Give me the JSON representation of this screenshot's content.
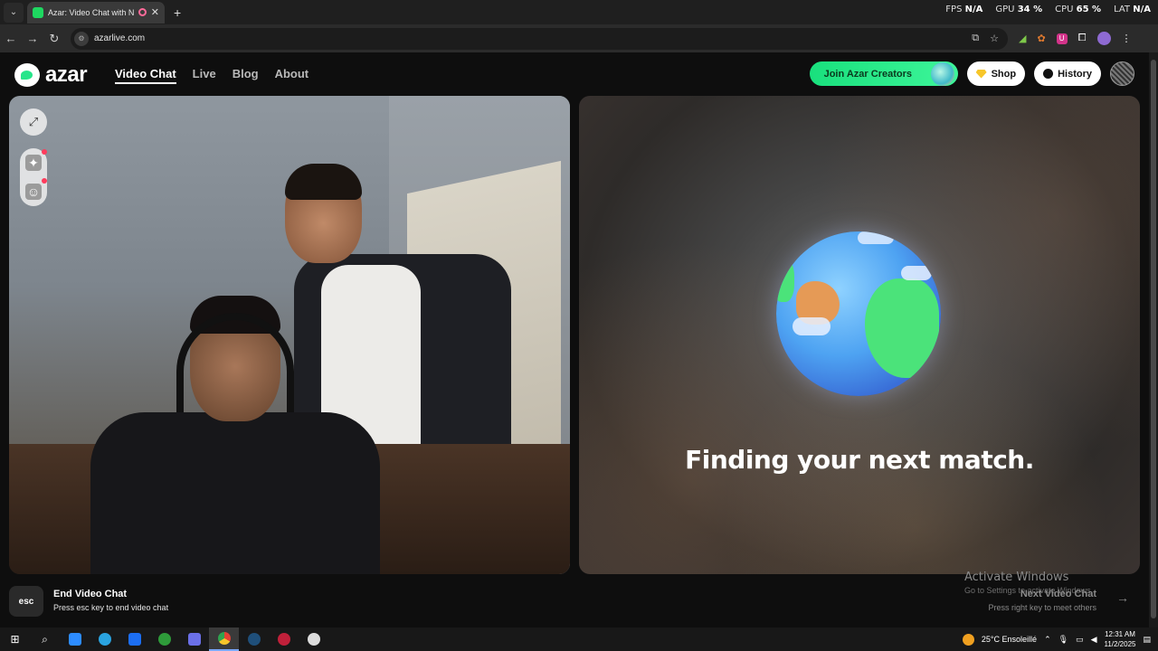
{
  "browser": {
    "tab_title": "Azar: Video Chat with New",
    "url": "azarlive.com",
    "hud": {
      "fps_label": "FPS",
      "fps_value": "N/A",
      "gpu_label": "GPU",
      "gpu_value": "34 %",
      "cpu_label": "CPU",
      "cpu_value": "65 %",
      "lat_label": "LAT",
      "lat_value": "N/A"
    }
  },
  "header": {
    "logo_text": "azar",
    "nav": [
      "Video Chat",
      "Live",
      "Blog",
      "About"
    ],
    "creators_label": "Join Azar Creators",
    "shop_label": "Shop",
    "history_label": "History"
  },
  "match": {
    "status_text": "Finding your next match."
  },
  "footer": {
    "esc_key": "esc",
    "end_title": "End Video Chat",
    "end_sub": "Press esc key to end video chat",
    "next_title": "Next Video Chat",
    "next_sub": "Press right key to meet others",
    "activate_title": "Activate Windows",
    "activate_sub": "Go to Settings to activate Windows."
  },
  "taskbar": {
    "weather": "25°C  Ensoleillé",
    "time": "12:31 AM",
    "date": "11/2/2025"
  },
  "colors": {
    "brand_green": "#1ed760",
    "accent_red": "#ff3b5c"
  }
}
